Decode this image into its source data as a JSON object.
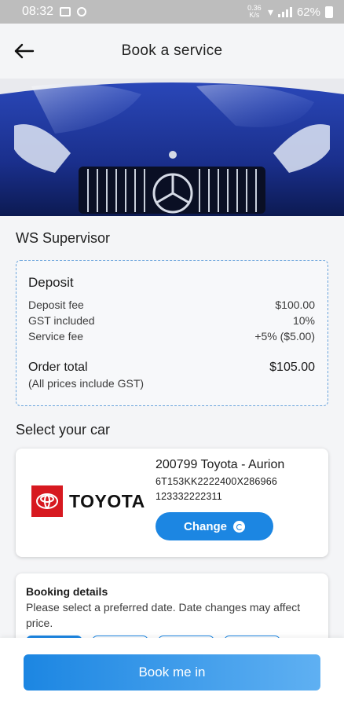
{
  "status_bar": {
    "time": "08:32",
    "network_speed": "0.36 K/s",
    "battery": "62%"
  },
  "header": {
    "title": "Book a service"
  },
  "provider": {
    "name": "WS Supervisor"
  },
  "deposit": {
    "heading": "Deposit",
    "rows": [
      {
        "label": "Deposit fee",
        "value": "$100.00"
      },
      {
        "label": "GST included",
        "value": "10%"
      },
      {
        "label": "Service fee",
        "value": "+5% ($5.00)"
      }
    ],
    "total_label": "Order total",
    "total_value": "$105.00",
    "note": "(All prices include GST)"
  },
  "car_section": {
    "title": "Select your car",
    "logo_text": "TOYOTA",
    "car_name": "200799 Toyota - Aurion",
    "vin": "6T153KK2222400X286966",
    "number": "123332222311",
    "change_label": "Change"
  },
  "booking": {
    "title": "Booking details",
    "description": "Please select a preferred date. Date changes may affect price."
  },
  "footer": {
    "book_label": "Book me in"
  },
  "colors": {
    "accent": "#1c86e2",
    "toyota_red": "#d71920"
  }
}
